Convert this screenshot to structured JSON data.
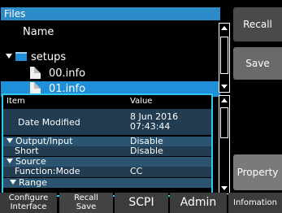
{
  "files": {
    "header": "Files",
    "name_row": "Name",
    "folder": "setups",
    "items": [
      "00.info",
      "01.info"
    ]
  },
  "details": {
    "col_item": "Item",
    "col_value": "Value",
    "rows": [
      {
        "key": "Date Modified",
        "value_line1": "8 Jun 2016",
        "value_line2": "07:43:44"
      },
      {
        "key": "Output/Input",
        "value": "Disable"
      },
      {
        "key": "Short",
        "value": "Disable"
      },
      {
        "key": "Source",
        "value": ""
      },
      {
        "key": "Function:Mode",
        "value": "CC"
      },
      {
        "key": "Range",
        "value": ""
      }
    ]
  },
  "side_buttons": {
    "recall": "Recall",
    "save": "Save",
    "property": "Property"
  },
  "bottom_tabs": {
    "configure_line1": "Configure",
    "configure_line2": "Interface",
    "recall_save_line1": "Recall",
    "recall_save_line2": "Save",
    "scpi": "SCPI",
    "admin": "Admin",
    "info": "Infomation"
  },
  "colors": {
    "header_blue": "#2a8bc8",
    "selection_blue": "#1e8fd8",
    "panel_border": "#30c8f0"
  }
}
